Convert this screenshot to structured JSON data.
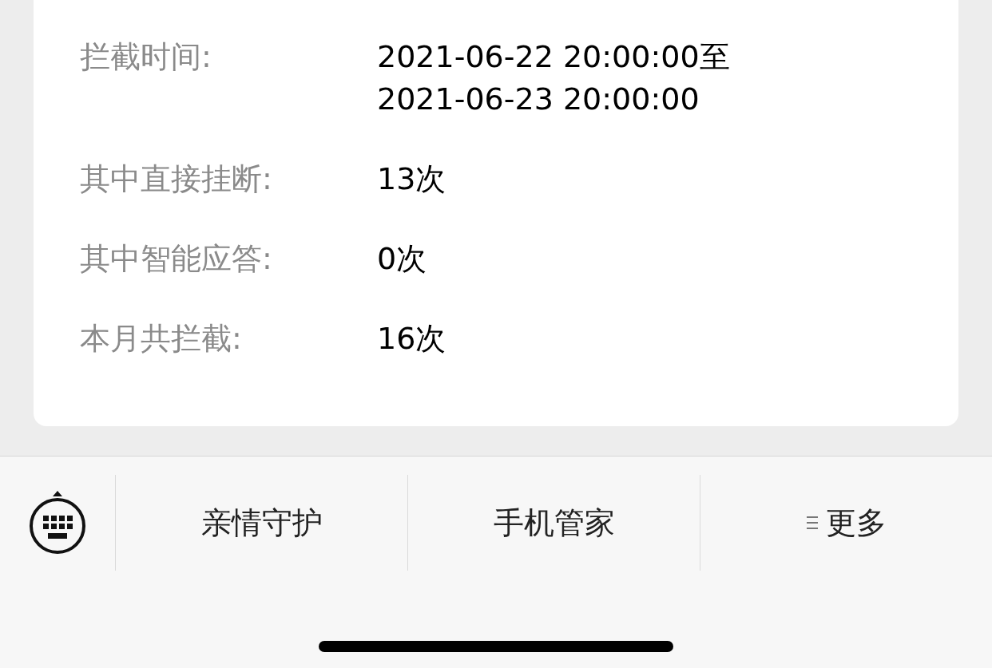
{
  "details": [
    {
      "label": "拦截时间:",
      "value_lines": [
        "2021-06-22 20:00:00至",
        "2021-06-23 20:00:00"
      ]
    },
    {
      "label": "其中直接挂断:",
      "value_lines": [
        "13次"
      ]
    },
    {
      "label": "其中智能应答:",
      "value_lines": [
        "0次"
      ]
    },
    {
      "label": "本月共拦截:",
      "value_lines": [
        "16次"
      ]
    }
  ],
  "bottom_menu": [
    {
      "kind": "keyboard"
    },
    {
      "kind": "text",
      "label": "亲情守护",
      "submenu": false
    },
    {
      "kind": "text",
      "label": "手机管家",
      "submenu": false
    },
    {
      "kind": "text",
      "label": "更多",
      "submenu": true
    }
  ]
}
